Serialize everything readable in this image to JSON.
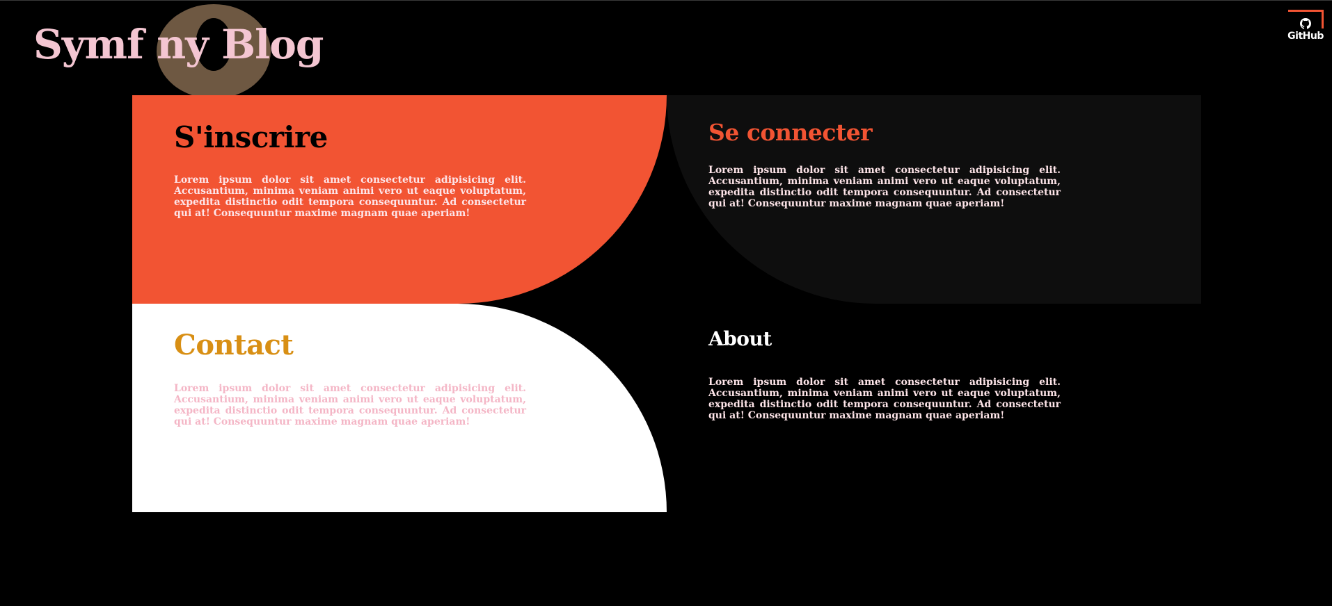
{
  "header": {
    "logo_title": "Symf ny Blog",
    "logo_o_color": "#6e5842",
    "github_label": "GitHub"
  },
  "panels": [
    {
      "id": "register",
      "heading": "S'inscrire",
      "text": "Lorem ipsum dolor sit amet consectetur adipisicing elit. Accusantium, minima veniam animi vero ut eaque voluptatum, expedita distinctio odit tempora consequuntur. Ad consectetur qui at! Consequuntur maxime magnam quae aperiam!",
      "background": "#f25433",
      "heading_color": "#000000"
    },
    {
      "id": "login",
      "heading": "Se connecter",
      "text": "Lorem ipsum dolor sit amet consectetur adipisicing elit. Accusantium, minima veniam animi vero ut eaque voluptatum, expedita distinctio odit tempora consequuntur. Ad consectetur qui at! Consequuntur maxime magnam quae aperiam!",
      "background": "#0e0e0e",
      "heading_color": "#f25433"
    },
    {
      "id": "contact",
      "heading": "Contact",
      "text": "Lorem ipsum dolor sit amet consectetur adipisicing elit. Accusantium, minima veniam animi vero ut eaque voluptatum, expedita distinctio odit tempora consequuntur. Ad consectetur qui at! Consequuntur maxime magnam quae aperiam!",
      "background": "#ffffff",
      "heading_color": "#d88f14"
    },
    {
      "id": "about",
      "heading": "About",
      "text": "Lorem ipsum dolor sit amet consectetur adipisicing elit. Accusantium, minima veniam animi vero ut eaque voluptatum, expedita distinctio odit tempora consequuntur. Ad consectetur qui at! Consequuntur maxime magnam quae aperiam!",
      "background": "#000000",
      "heading_color": "#ffffff"
    }
  ],
  "colors": {
    "page_background": "#000000",
    "accent": "#f25433",
    "pink_text": "#f4c6d2"
  }
}
